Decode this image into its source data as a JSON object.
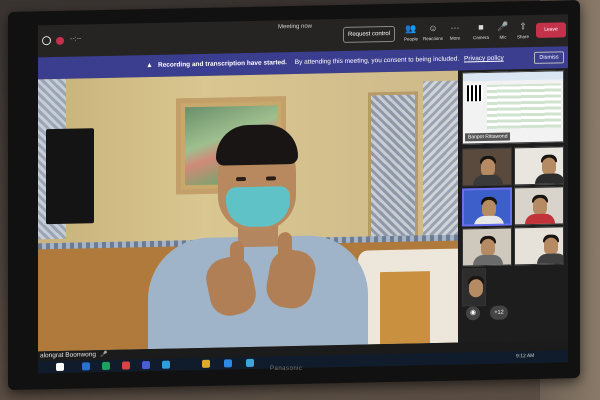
{
  "window": {
    "title": "Meeting now",
    "timer": "--:--"
  },
  "toolbar": {
    "request_control": "Request control",
    "buttons": [
      {
        "icon": "people-icon",
        "glyph": "👥",
        "label": "People"
      },
      {
        "icon": "reactions-icon",
        "glyph": "☺",
        "label": "Reactions"
      },
      {
        "icon": "more-icon",
        "glyph": "···",
        "label": "More"
      },
      {
        "icon": "camera-icon",
        "glyph": "■",
        "label": "Camera"
      },
      {
        "icon": "mic-icon",
        "glyph": "🎤",
        "label": "Mic"
      },
      {
        "icon": "share-icon",
        "glyph": "⇧",
        "label": "Share"
      }
    ],
    "leave": "Leave"
  },
  "banner": {
    "headline": "Recording and transcription have started.",
    "body": "By attending this meeting, you consent to being included.",
    "link": "Privacy policy",
    "dismiss": "Dismiss"
  },
  "gallery": {
    "share_name": "Banpot Rittawond",
    "overflow_count": "+12"
  },
  "presenter": {
    "name": "alongrat Boonwong"
  },
  "taskbar": {
    "time": "9:12 AM"
  },
  "tv_brand": "Panasonic",
  "colors": {
    "banner": "#3b3d8f",
    "leave": "#c4314b",
    "titlebar": "#252423"
  }
}
